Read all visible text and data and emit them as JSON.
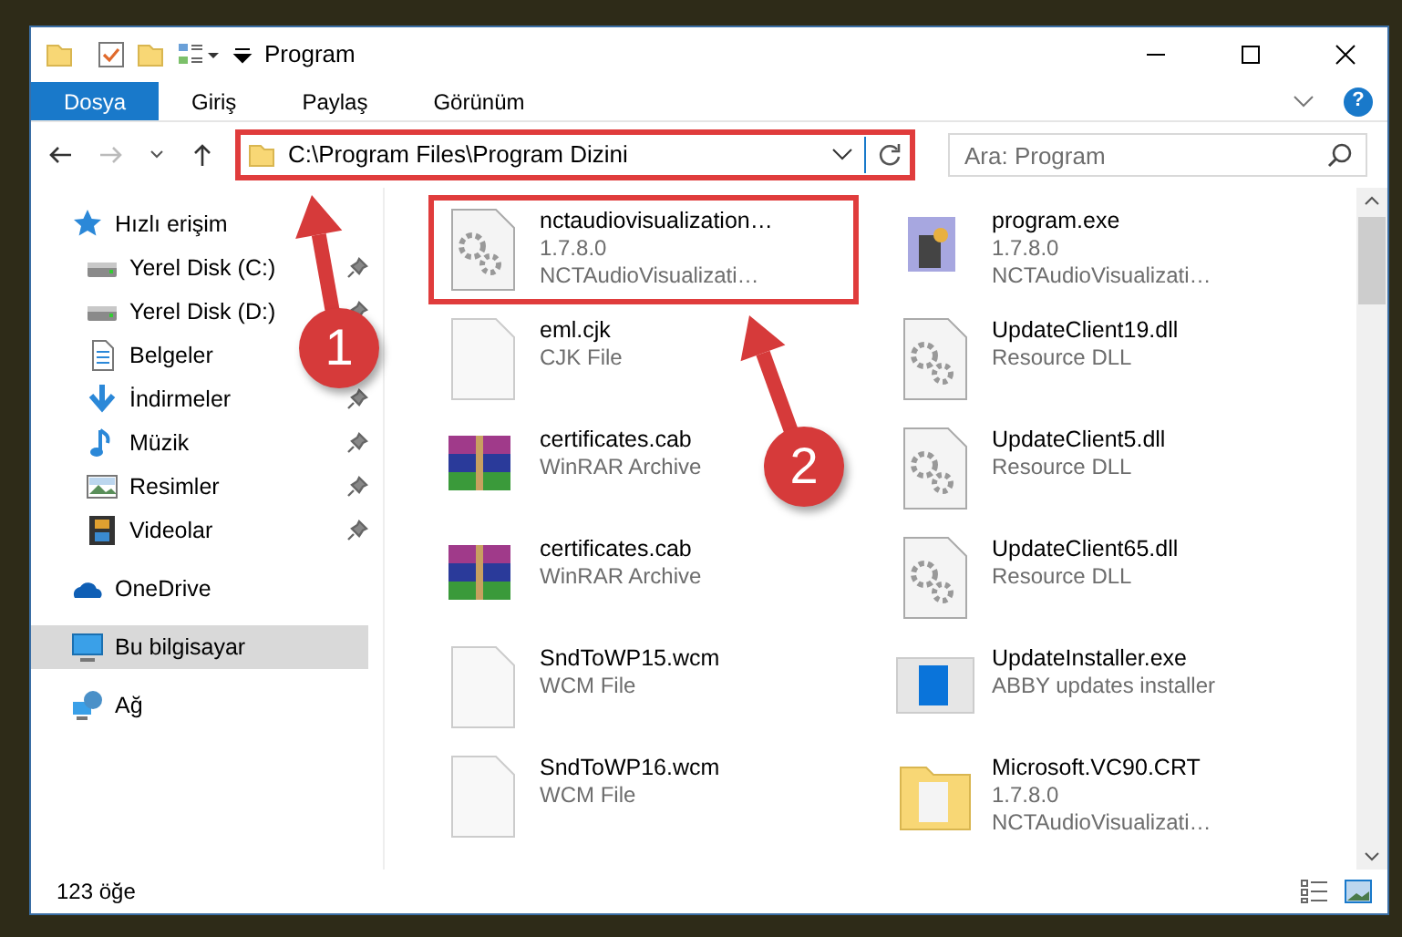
{
  "window": {
    "title": "Program"
  },
  "help_button": "?",
  "ribbon_tabs": [
    {
      "label": "Dosya",
      "selected": true
    },
    {
      "label": "Giriş",
      "selected": false
    },
    {
      "label": "Paylaş",
      "selected": false
    },
    {
      "label": "Görünüm",
      "selected": false
    }
  ],
  "address": {
    "path": "C:\\Program Files\\Program Dizini",
    "highlighted": true
  },
  "search": {
    "placeholder": "Ara: Program"
  },
  "sidebar": {
    "items": [
      {
        "label": "Hızlı erişim",
        "kind": "quick",
        "selected": false,
        "children": [
          {
            "label": "Yerel Disk (C:)",
            "kind": "drive",
            "pinned": true,
            "selected": false
          },
          {
            "label": "Yerel Disk (D:)",
            "kind": "drive",
            "pinned": true,
            "selected": false
          },
          {
            "label": "Belgeler",
            "kind": "docs",
            "selected": false
          },
          {
            "label": "İndirmeler",
            "kind": "download",
            "pinned": true,
            "selected": false
          },
          {
            "label": "Müzik",
            "kind": "music",
            "pinned": true,
            "selected": false
          },
          {
            "label": "Resimler",
            "kind": "pictures",
            "pinned": true,
            "selected": false
          },
          {
            "label": "Videolar",
            "kind": "videos",
            "pinned": true,
            "selected": false
          }
        ]
      },
      {
        "label": "OneDrive",
        "kind": "onedrive",
        "selected": false
      },
      {
        "label": "Bu bilgisayar",
        "kind": "pc",
        "selected": true
      },
      {
        "label": "Ağ",
        "kind": "network",
        "selected": false
      }
    ]
  },
  "files": [
    {
      "name": "nctaudiovisualization…",
      "details": [
        "1.7.8.0",
        "NCTAudioVisualizati…"
      ],
      "kind": "gear",
      "highlighted": true
    },
    {
      "name": "program.exe",
      "details": [
        "1.7.8.0",
        "NCTAudioVisualizati…"
      ],
      "kind": "exe",
      "highlighted": false
    },
    {
      "name": "eml.cjk",
      "details": [
        "CJK File"
      ],
      "kind": "blank",
      "highlighted": false
    },
    {
      "name": "UpdateClient19.dll",
      "details": [
        "Resource DLL"
      ],
      "kind": "gear",
      "highlighted": false
    },
    {
      "name": "certificates.cab",
      "details": [
        "WinRAR Archive"
      ],
      "kind": "archive",
      "highlighted": false
    },
    {
      "name": "UpdateClient5.dll",
      "details": [
        "Resource DLL"
      ],
      "kind": "gear",
      "highlighted": false
    },
    {
      "name": "certificates.cab",
      "details": [
        "WinRAR Archive"
      ],
      "kind": "archive",
      "highlighted": false
    },
    {
      "name": "UpdateClient65.dll",
      "details": [
        "Resource DLL"
      ],
      "kind": "gear",
      "highlighted": false
    },
    {
      "name": "SndToWP15.wcm",
      "details": [
        "WCM File"
      ],
      "kind": "blank",
      "highlighted": false
    },
    {
      "name": "UpdateInstaller.exe",
      "details": [
        "ABBY updates installer"
      ],
      "kind": "installer",
      "highlighted": false
    },
    {
      "name": "SndToWP16.wcm",
      "details": [
        "WCM File"
      ],
      "kind": "blank",
      "highlighted": false
    },
    {
      "name": "Microsoft.VC90.CRT",
      "details": [
        "1.7.8.0",
        "NCTAudioVisualizati…"
      ],
      "kind": "folder",
      "highlighted": false
    }
  ],
  "status_bar": {
    "count": "123 öğe"
  },
  "annotations": [
    {
      "label": "1"
    },
    {
      "label": "2"
    }
  ]
}
